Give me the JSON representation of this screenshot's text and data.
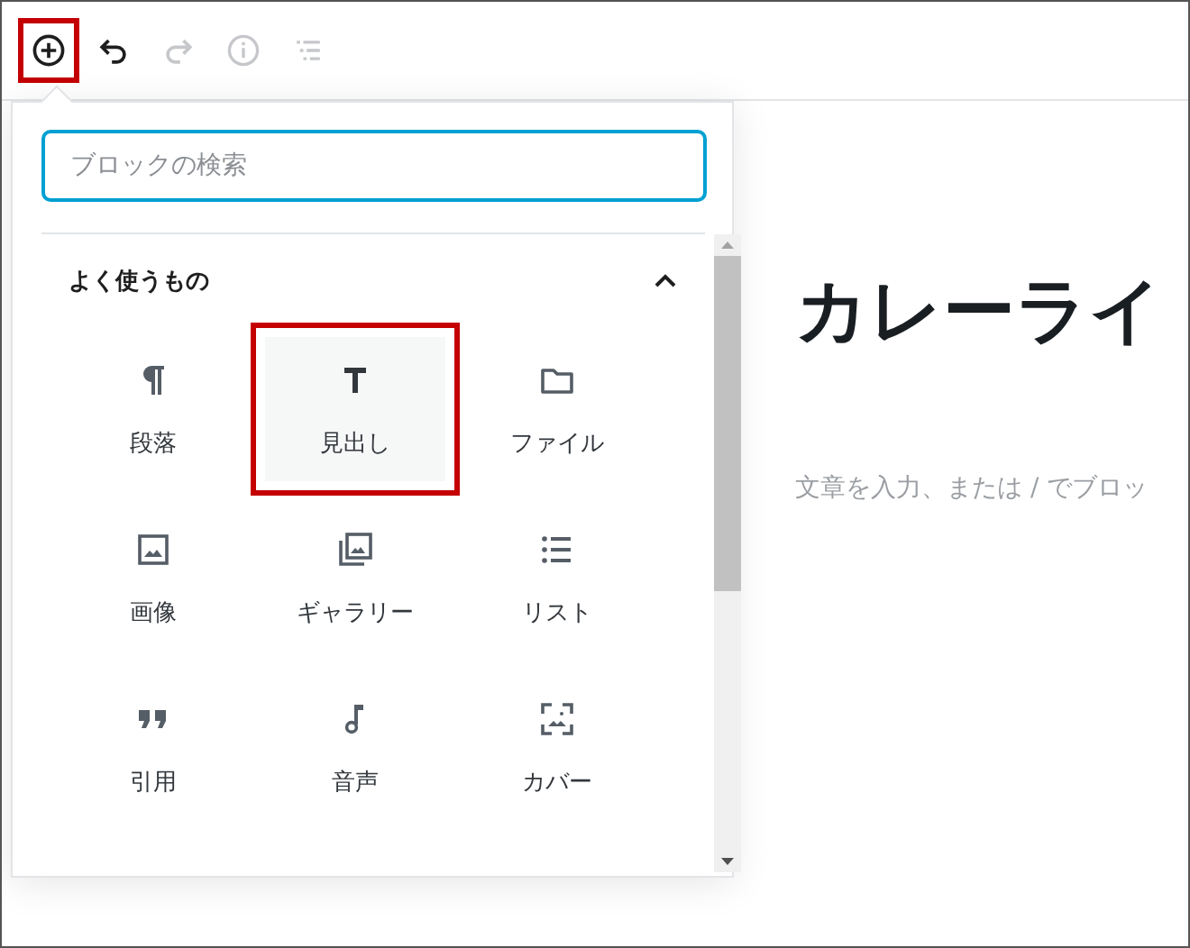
{
  "toolbar": [
    {
      "kind": "add",
      "highlighted": true,
      "disabled": false
    },
    {
      "kind": "undo",
      "highlighted": false,
      "disabled": false
    },
    {
      "kind": "redo",
      "highlighted": false,
      "disabled": true
    },
    {
      "kind": "info",
      "highlighted": false,
      "disabled": true
    },
    {
      "kind": "outline",
      "highlighted": false,
      "disabled": true
    }
  ],
  "inserter": {
    "search": {
      "placeholder": "ブロックの検索"
    },
    "section": {
      "title": "よく使うもの",
      "expanded": true
    },
    "blocks": [
      {
        "kind": "paragraph",
        "label": "段落",
        "highlighted": false
      },
      {
        "kind": "heading",
        "label": "見出し",
        "highlighted": true
      },
      {
        "kind": "file",
        "label": "ファイル",
        "highlighted": false
      },
      {
        "kind": "image",
        "label": "画像",
        "highlighted": false
      },
      {
        "kind": "gallery",
        "label": "ギャラリー",
        "highlighted": false
      },
      {
        "kind": "list",
        "label": "リスト",
        "highlighted": false
      },
      {
        "kind": "quote",
        "label": "引用",
        "highlighted": false
      },
      {
        "kind": "audio",
        "label": "音声",
        "highlighted": false
      },
      {
        "kind": "cover",
        "label": "カバー",
        "highlighted": false
      }
    ]
  },
  "editor": {
    "title": "カレーライ",
    "placeholder": "文章を入力、または / でブロッ"
  }
}
